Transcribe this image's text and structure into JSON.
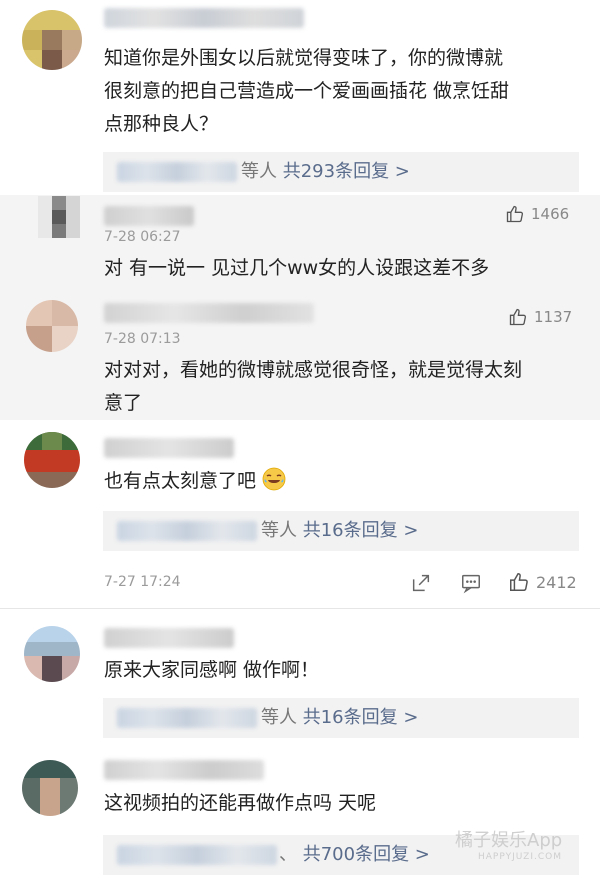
{
  "comments": [
    {
      "text_lines": [
        "知道你是外围女以后就觉得变味了，你的微博就",
        "很刻意的把自己营造成一个爱画画插花 做烹饪甜",
        "点那种良人？"
      ],
      "reply_suffix": "等人",
      "reply_count": "共293条回复 >",
      "sub_replies": [
        {
          "time": "7-28 06:27",
          "likes": "1466",
          "text": "对 有一说一 见过几个ww女的人设跟这差不多"
        },
        {
          "time": "7-28 07:13",
          "likes": "1137",
          "text_lines": [
            "对对对，看她的微博就感觉很奇怪，就是觉得太刻",
            "意了"
          ]
        }
      ]
    },
    {
      "text": "也有点太刻意了吧",
      "reply_suffix": "等人",
      "reply_count": "共16条回复 >",
      "time": "7-27 17:24",
      "likes": "2412"
    },
    {
      "text": "原来大家同感啊 做作啊！",
      "reply_suffix": "等人",
      "reply_count": "共16条回复 >"
    },
    {
      "text": "这视频拍的还能再做作点吗 天呢",
      "reply_suffix": "、",
      "reply_count": "共700条回复 >"
    }
  ],
  "icons": {
    "like": "thumbs-up-icon",
    "share": "share-icon",
    "comment": "comment-icon",
    "emoji": "laughing-crying-emoji"
  },
  "watermark": {
    "brand": "橘子娱乐App",
    "url": "HAPPYJUZI.COM"
  },
  "colors": {
    "link": "#5a6c8c",
    "reply_bg": "#f2f2f2",
    "subthread_bg": "#f4f4f4"
  }
}
